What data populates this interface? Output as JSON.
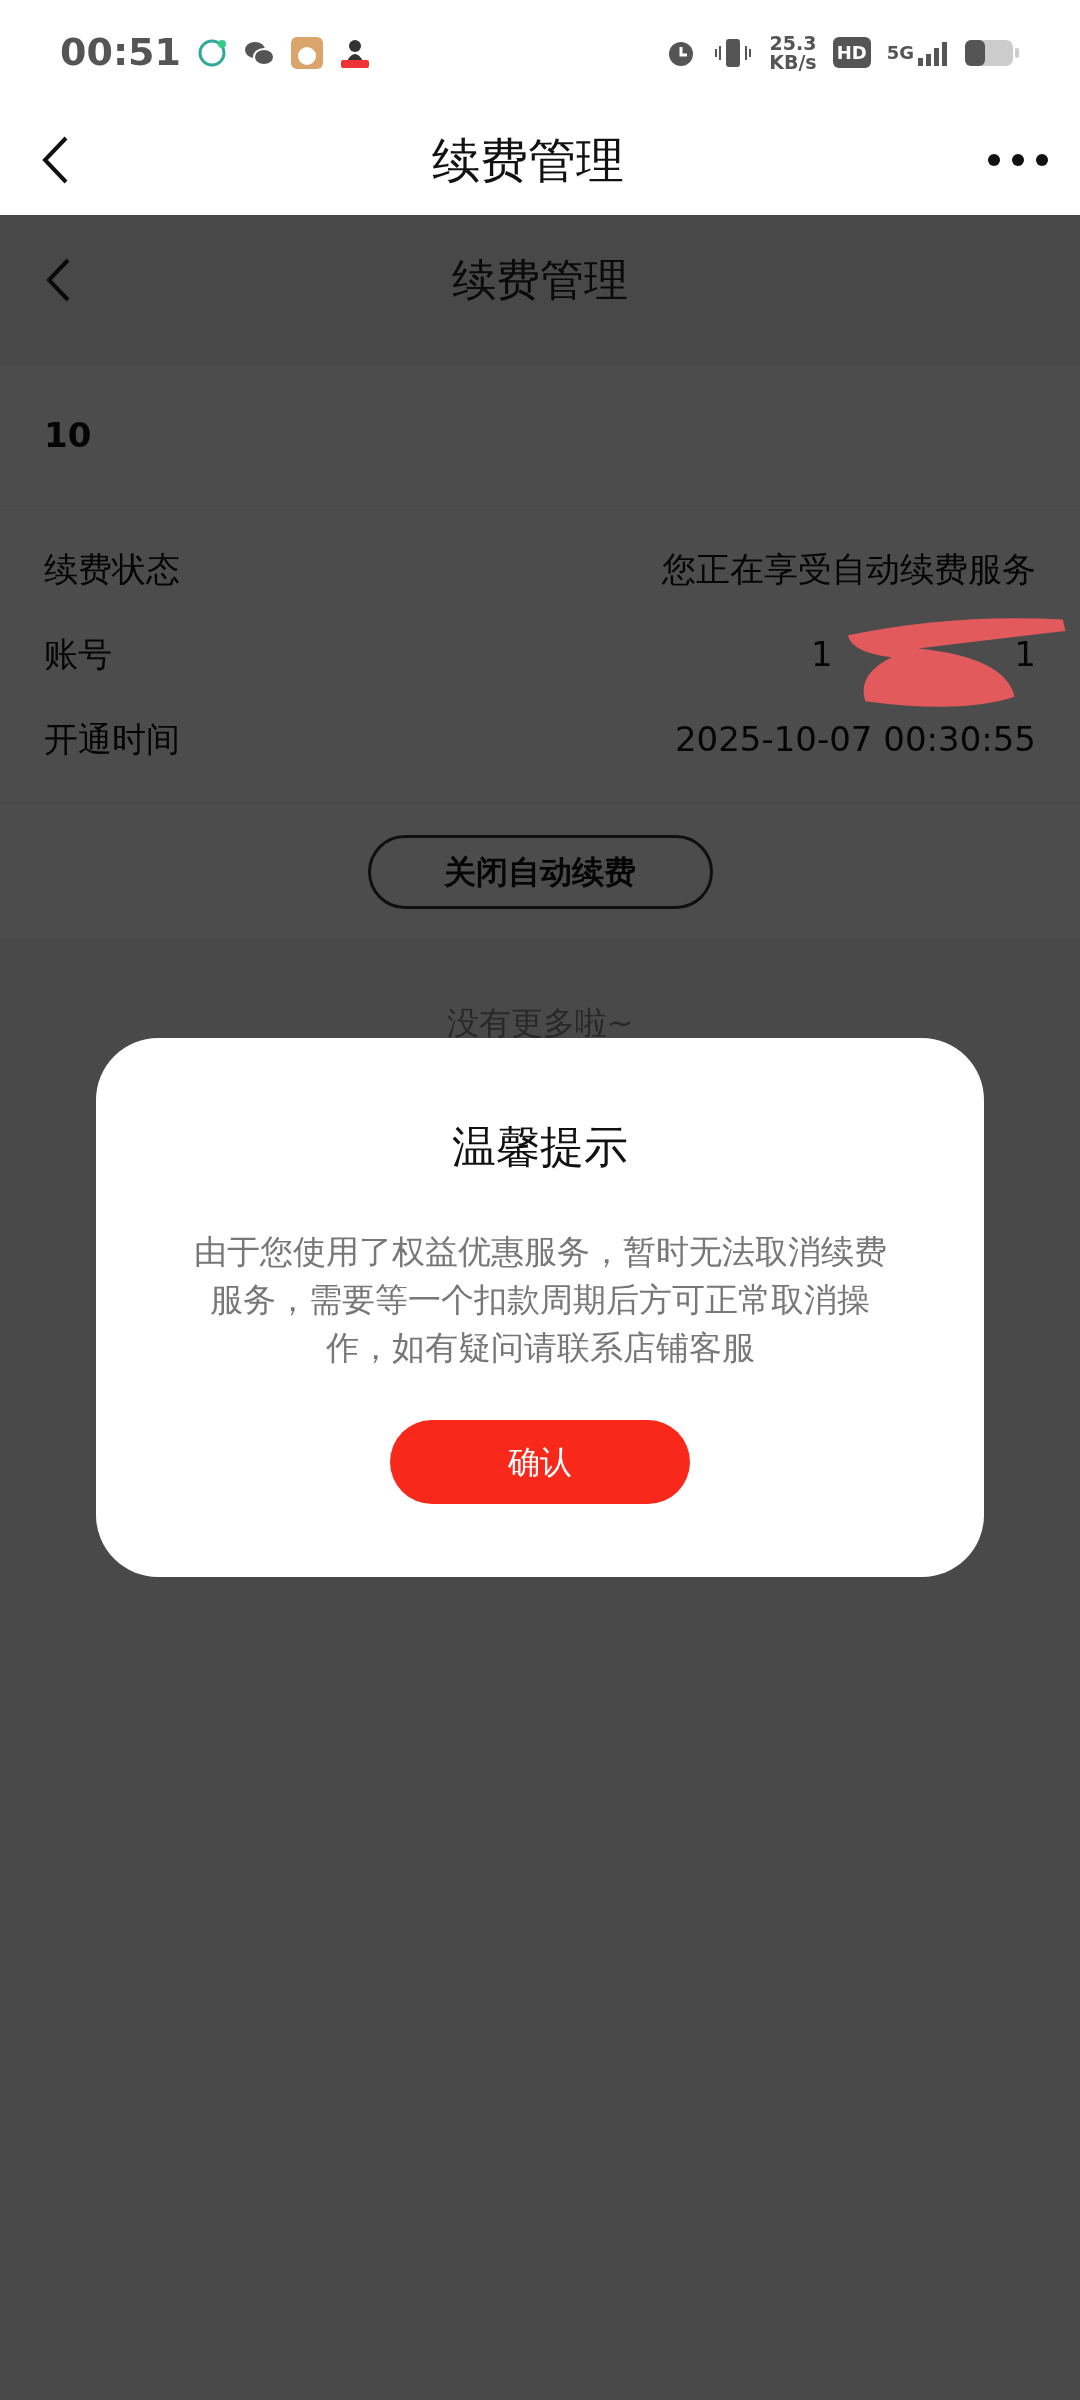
{
  "status_bar": {
    "time": "00:51",
    "net_speed": "25.3",
    "net_unit": "KB/s",
    "hd": "HD",
    "network": "5G"
  },
  "app_bar": {
    "title": "续费管理"
  },
  "page": {
    "header": {
      "title": "续费管理"
    },
    "plan": "10",
    "rows": [
      {
        "label": "续费状态",
        "value": "您正在享受自动续费服务",
        "kind": "text"
      },
      {
        "label": "账号",
        "value_start": "1",
        "value_end": "1",
        "kind": "redacted"
      },
      {
        "label": "开通时间",
        "value": "2025-10-07 00:30:55",
        "kind": "text"
      }
    ],
    "action_button": "关闭自动续费",
    "footer": "没有更多啦~"
  },
  "dialog": {
    "title": "温馨提示",
    "message": "由于您使用了权益优惠服务，暂时无法取消续费服务，需要等一个扣款周期后方可正常取消操作，如有疑问请联系店铺客服",
    "confirm": "确认"
  }
}
